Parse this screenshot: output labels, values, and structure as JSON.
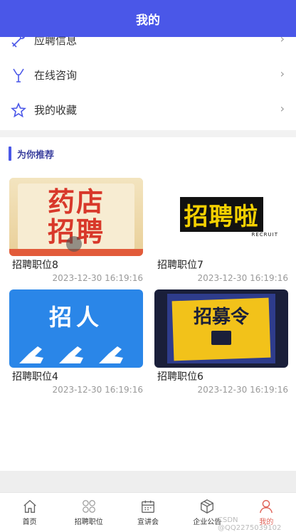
{
  "header": {
    "title": "我的"
  },
  "menu": {
    "items": [
      {
        "label": "应聘信息",
        "icon": "wrench-icon",
        "arrow": "›"
      },
      {
        "label": "在线咨询",
        "icon": "antenna-icon",
        "arrow": "›"
      },
      {
        "label": "我的收藏",
        "icon": "star-icon",
        "arrow": "›"
      }
    ]
  },
  "recommend": {
    "title": "为你推荐",
    "cards": [
      {
        "name": "招聘职位8",
        "date": "2023-12-30 16:19:16",
        "image_text": "药店招聘"
      },
      {
        "name": "招聘职位7",
        "date": "2023-12-30 16:19:16",
        "image_text": "招聘啦",
        "image_subtext": "RECRUIT"
      },
      {
        "name": "招聘职位4",
        "date": "2023-12-30 16:19:16",
        "image_text": "招人"
      },
      {
        "name": "招聘职位6",
        "date": "2023-12-30 16:19:16",
        "image_text": "招募令"
      }
    ]
  },
  "tabbar": {
    "tabs": [
      {
        "label": "首页",
        "icon": "home-icon"
      },
      {
        "label": "招聘职位",
        "icon": "grid-icon"
      },
      {
        "label": "宣讲会",
        "icon": "calendar-icon"
      },
      {
        "label": "企业公告",
        "icon": "box-icon"
      },
      {
        "label": "我的",
        "icon": "user-icon",
        "active": true
      }
    ]
  },
  "watermark": "CSDN @QQ2275039102",
  "colors": {
    "primary": "#4a57e8",
    "active_tab": "#e0645a"
  }
}
